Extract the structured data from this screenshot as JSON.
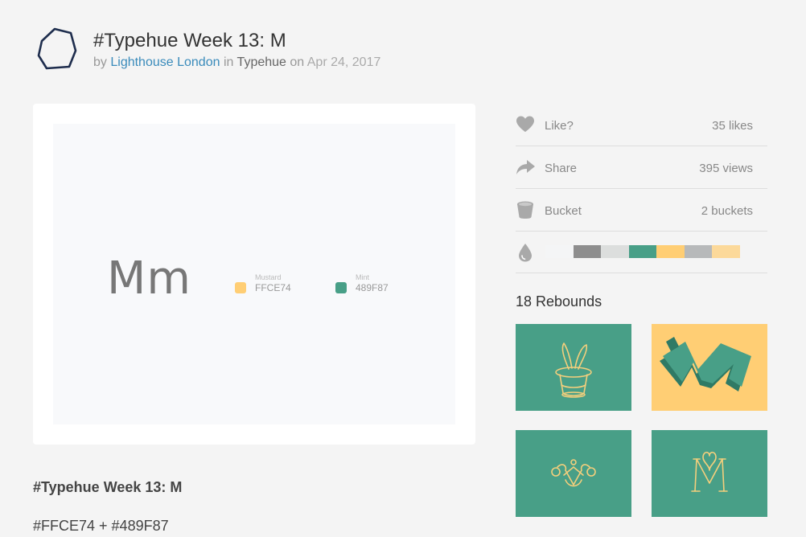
{
  "header": {
    "title": "#Typehue Week 13: M",
    "by": "by",
    "author": "Lighthouse London",
    "in": "in",
    "team": "Typehue",
    "on": "on",
    "date": "Apr 24, 2017"
  },
  "shot": {
    "letters": "Mm",
    "swatches": [
      {
        "name": "Mustard",
        "hex": "FFCE74",
        "color": "#ffce74"
      },
      {
        "name": "Mint",
        "hex": "489F87",
        "color": "#489f87"
      }
    ]
  },
  "description": {
    "title": "#Typehue Week 13: M",
    "text": "#FFCE74 + #489F87"
  },
  "sidebar": {
    "like": {
      "label": "Like?",
      "value": "35 likes",
      "icon": "heart-icon"
    },
    "share": {
      "label": "Share",
      "value": "395 views",
      "icon": "share-arrow-icon"
    },
    "bucket": {
      "label": "Bucket",
      "value": "2 buckets",
      "icon": "bucket-icon"
    },
    "palette": {
      "icon": "droplet-icon",
      "colors": [
        "#f4f5f6",
        "#8e8e8e",
        "#dcdedd",
        "#489f87",
        "#ffce74",
        "#b7b9ba",
        "#fcd99a"
      ]
    }
  },
  "rebounds": {
    "title": "18 Rebounds",
    "items": [
      {
        "name": "magic-hat-rebound",
        "bg": "#489f87"
      },
      {
        "name": "isometric-m-rebound",
        "bg": "#ffce74"
      },
      {
        "name": "crown-ornament-rebound",
        "bg": "#489f87"
      },
      {
        "name": "monogram-m-rebound",
        "bg": "#489f87"
      }
    ]
  },
  "colors": {
    "accent_link": "#3a8bbb",
    "mustard": "#ffce74",
    "mint": "#489f87"
  }
}
